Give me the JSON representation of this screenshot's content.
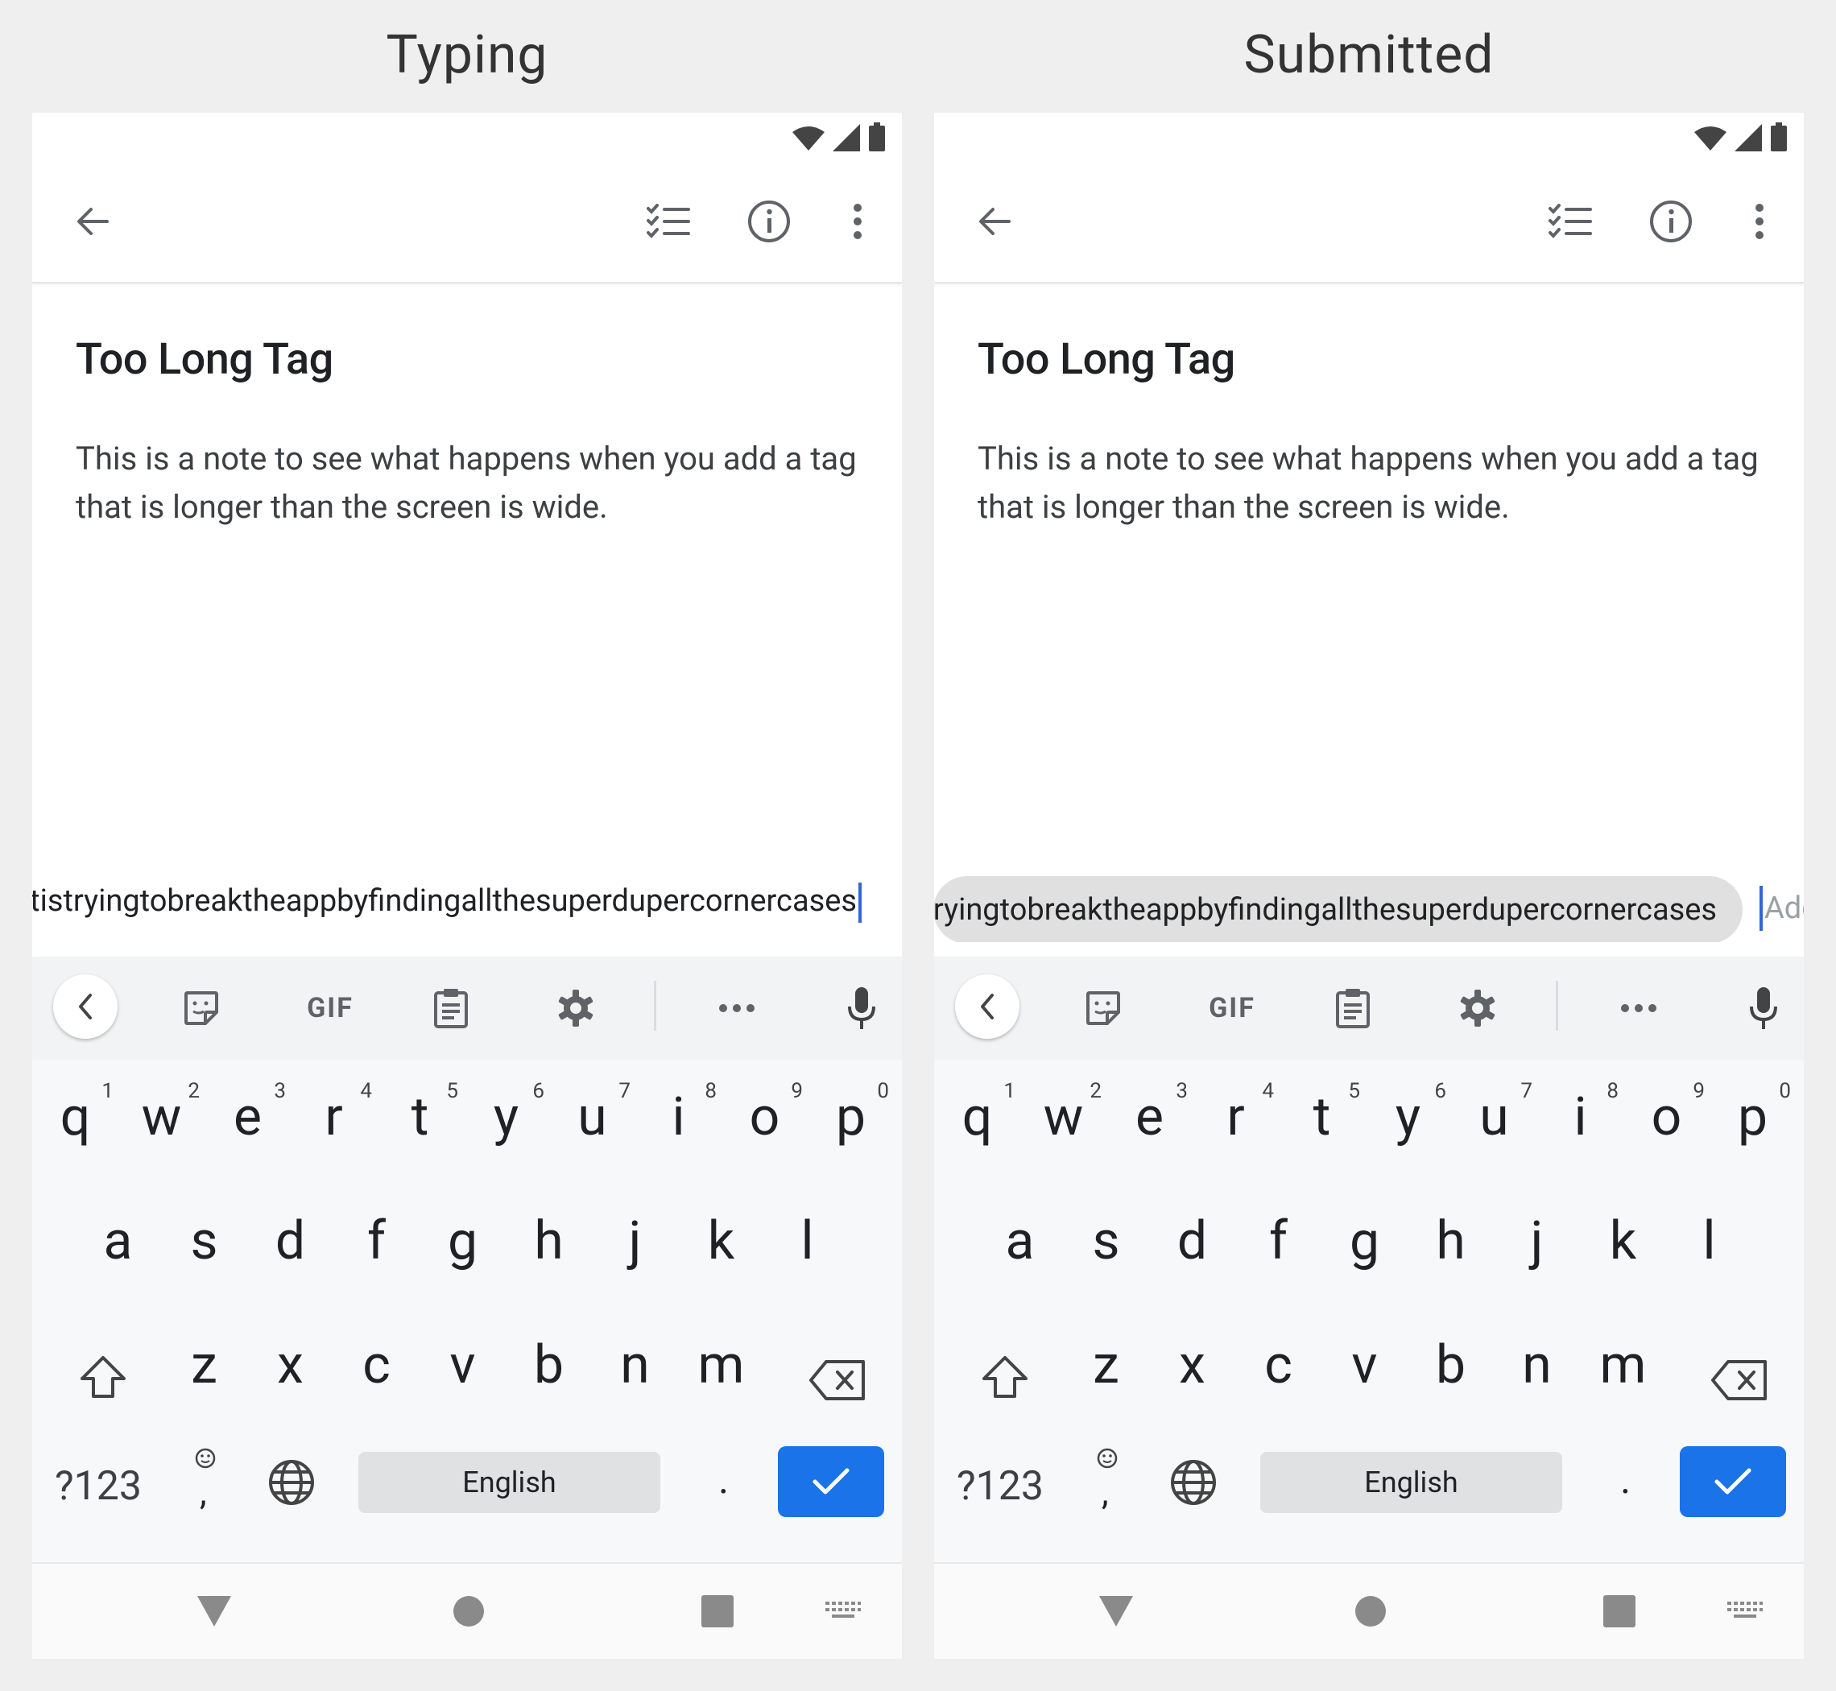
{
  "panels": [
    {
      "caption": "Typing",
      "note_title": "Too Long Tag",
      "note_body": "This is a note to see what happens when you add a tag that is longer than the screen is wide.",
      "tag_text": "atistryingtobreaktheappbyfindingallthesuperdupercornercases",
      "add_placeholder": ""
    },
    {
      "caption": "Submitted",
      "note_title": "Too Long Tag",
      "note_body": "This is a note to see what happens when you add a tag that is longer than the screen is wide.",
      "tag_text": "ryingtobreaktheappbyfindingallthesuperdupercornercases",
      "add_placeholder": "Add"
    }
  ],
  "keyboard": {
    "toolbar_gif": "GIF",
    "row1": [
      {
        "key": "q",
        "hint": "1"
      },
      {
        "key": "w",
        "hint": "2"
      },
      {
        "key": "e",
        "hint": "3"
      },
      {
        "key": "r",
        "hint": "4"
      },
      {
        "key": "t",
        "hint": "5"
      },
      {
        "key": "y",
        "hint": "6"
      },
      {
        "key": "u",
        "hint": "7"
      },
      {
        "key": "i",
        "hint": "8"
      },
      {
        "key": "o",
        "hint": "9"
      },
      {
        "key": "p",
        "hint": "0"
      }
    ],
    "row2": [
      "a",
      "s",
      "d",
      "f",
      "g",
      "h",
      "j",
      "k",
      "l"
    ],
    "row3": [
      "z",
      "x",
      "c",
      "v",
      "b",
      "n",
      "m"
    ],
    "symbols_key": "?123",
    "comma_key": ",",
    "space_label": "English",
    "period_key": "."
  },
  "colors": {
    "accent": "#1a73e8",
    "caret": "#3367d6",
    "chip": "#e0e0e0"
  },
  "icons": {
    "back": "arrow-left-icon",
    "checklist": "checklist-icon",
    "info": "info-icon",
    "more": "more-vert-icon"
  }
}
